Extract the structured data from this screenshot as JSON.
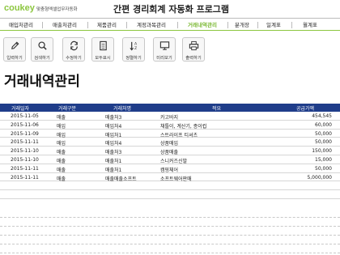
{
  "header": {
    "logo": "coukey",
    "logo_sub": "맞춤형엑셀업무자동화",
    "title": "간편 경리회계 자동화 프로그램"
  },
  "nav": {
    "items": [
      {
        "label": "매입처관리",
        "active": false
      },
      {
        "label": "매출처관리",
        "active": false
      },
      {
        "label": "제품관리",
        "active": false
      },
      {
        "label": "계정과목관리",
        "active": false
      },
      {
        "label": "거래내역관리",
        "active": true
      },
      {
        "label": "분개장",
        "active": false
      },
      {
        "label": "일계표",
        "active": false
      },
      {
        "label": "월계표",
        "active": false
      }
    ]
  },
  "toolbar": {
    "buttons": [
      {
        "label": "입력하기",
        "icon": "pencil-icon"
      },
      {
        "label": "검색하기",
        "icon": "magnifier-icon"
      },
      {
        "label": "수정하기",
        "icon": "refresh-icon"
      },
      {
        "label": "모두표시",
        "icon": "document-icon"
      },
      {
        "label": "정렬하기",
        "icon": "sort-icon"
      },
      {
        "label": "미리보기",
        "icon": "monitor-icon"
      },
      {
        "label": "출력하기",
        "icon": "printer-icon"
      }
    ]
  },
  "page_title": "거래내역관리",
  "grid": {
    "columns": [
      "거래일자",
      "거래구분",
      "거래처명",
      "적요",
      "공급가액"
    ],
    "rows": [
      [
        "2015-11-05",
        "매출",
        "매출처3",
        "카고바지",
        "454,545"
      ],
      [
        "2015-11-06",
        "매입",
        "매입처4",
        "채틀이, 계산기, 종이컵",
        "60,000"
      ],
      [
        "2015-11-09",
        "매입",
        "매입처1",
        "스트라이프 티셔츠",
        "50,000"
      ],
      [
        "2015-11-11",
        "매입",
        "매입처4",
        "상품매입",
        "50,000"
      ],
      [
        "2015-11-10",
        "매출",
        "매출처3",
        "상품매출",
        "150,000"
      ],
      [
        "2015-11-10",
        "매출",
        "매출처1",
        "스니커즈신발",
        "15,000"
      ],
      [
        "2015-11-11",
        "매출",
        "매출처1",
        "캠핑체어",
        "50,000"
      ],
      [
        "2015-11-11",
        "매출",
        "매출매출소프트",
        "소프트웨어판매",
        "5,000,000"
      ]
    ]
  },
  "colors": {
    "brand_green": "#8cc63f",
    "grid_header": "#1f3d8a"
  }
}
